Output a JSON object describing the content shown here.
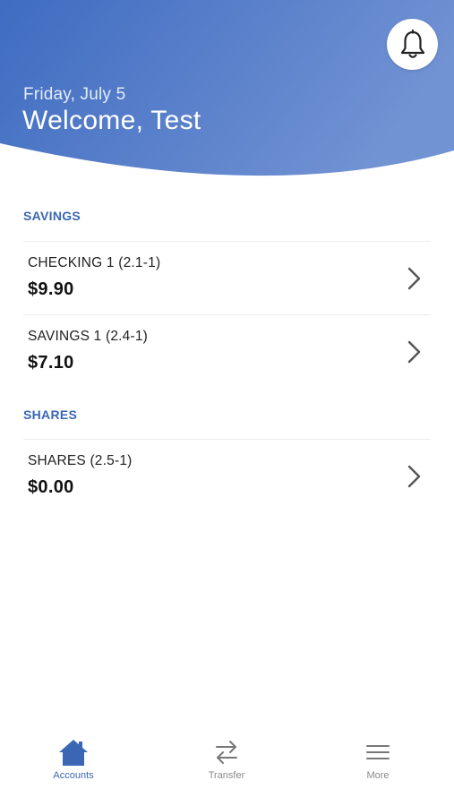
{
  "header": {
    "date": "Friday, July 5",
    "welcome": "Welcome, Test",
    "bell_icon": "bell-icon",
    "gradient_start": "#3f6cc1",
    "gradient_end": "#7192d3"
  },
  "sections": [
    {
      "title": "SAVINGS",
      "accounts": [
        {
          "name": "CHECKING 1 (2.1-1)",
          "amount": "$9.90"
        },
        {
          "name": "SAVINGS 1 (2.4-1)",
          "amount": "$7.10"
        }
      ]
    },
    {
      "title": "SHARES",
      "accounts": [
        {
          "name": "SHARES (2.5-1)",
          "amount": "$0.00"
        }
      ]
    }
  ],
  "nav": {
    "items": [
      {
        "label": "Accounts",
        "icon": "home-icon",
        "active": true
      },
      {
        "label": "Transfer",
        "icon": "transfer-arrows-icon",
        "active": false
      },
      {
        "label": "More",
        "icon": "menu-icon",
        "active": false
      }
    ]
  },
  "colors": {
    "accent": "#3a66b4",
    "nav_inactive": "#8a8a8a"
  }
}
